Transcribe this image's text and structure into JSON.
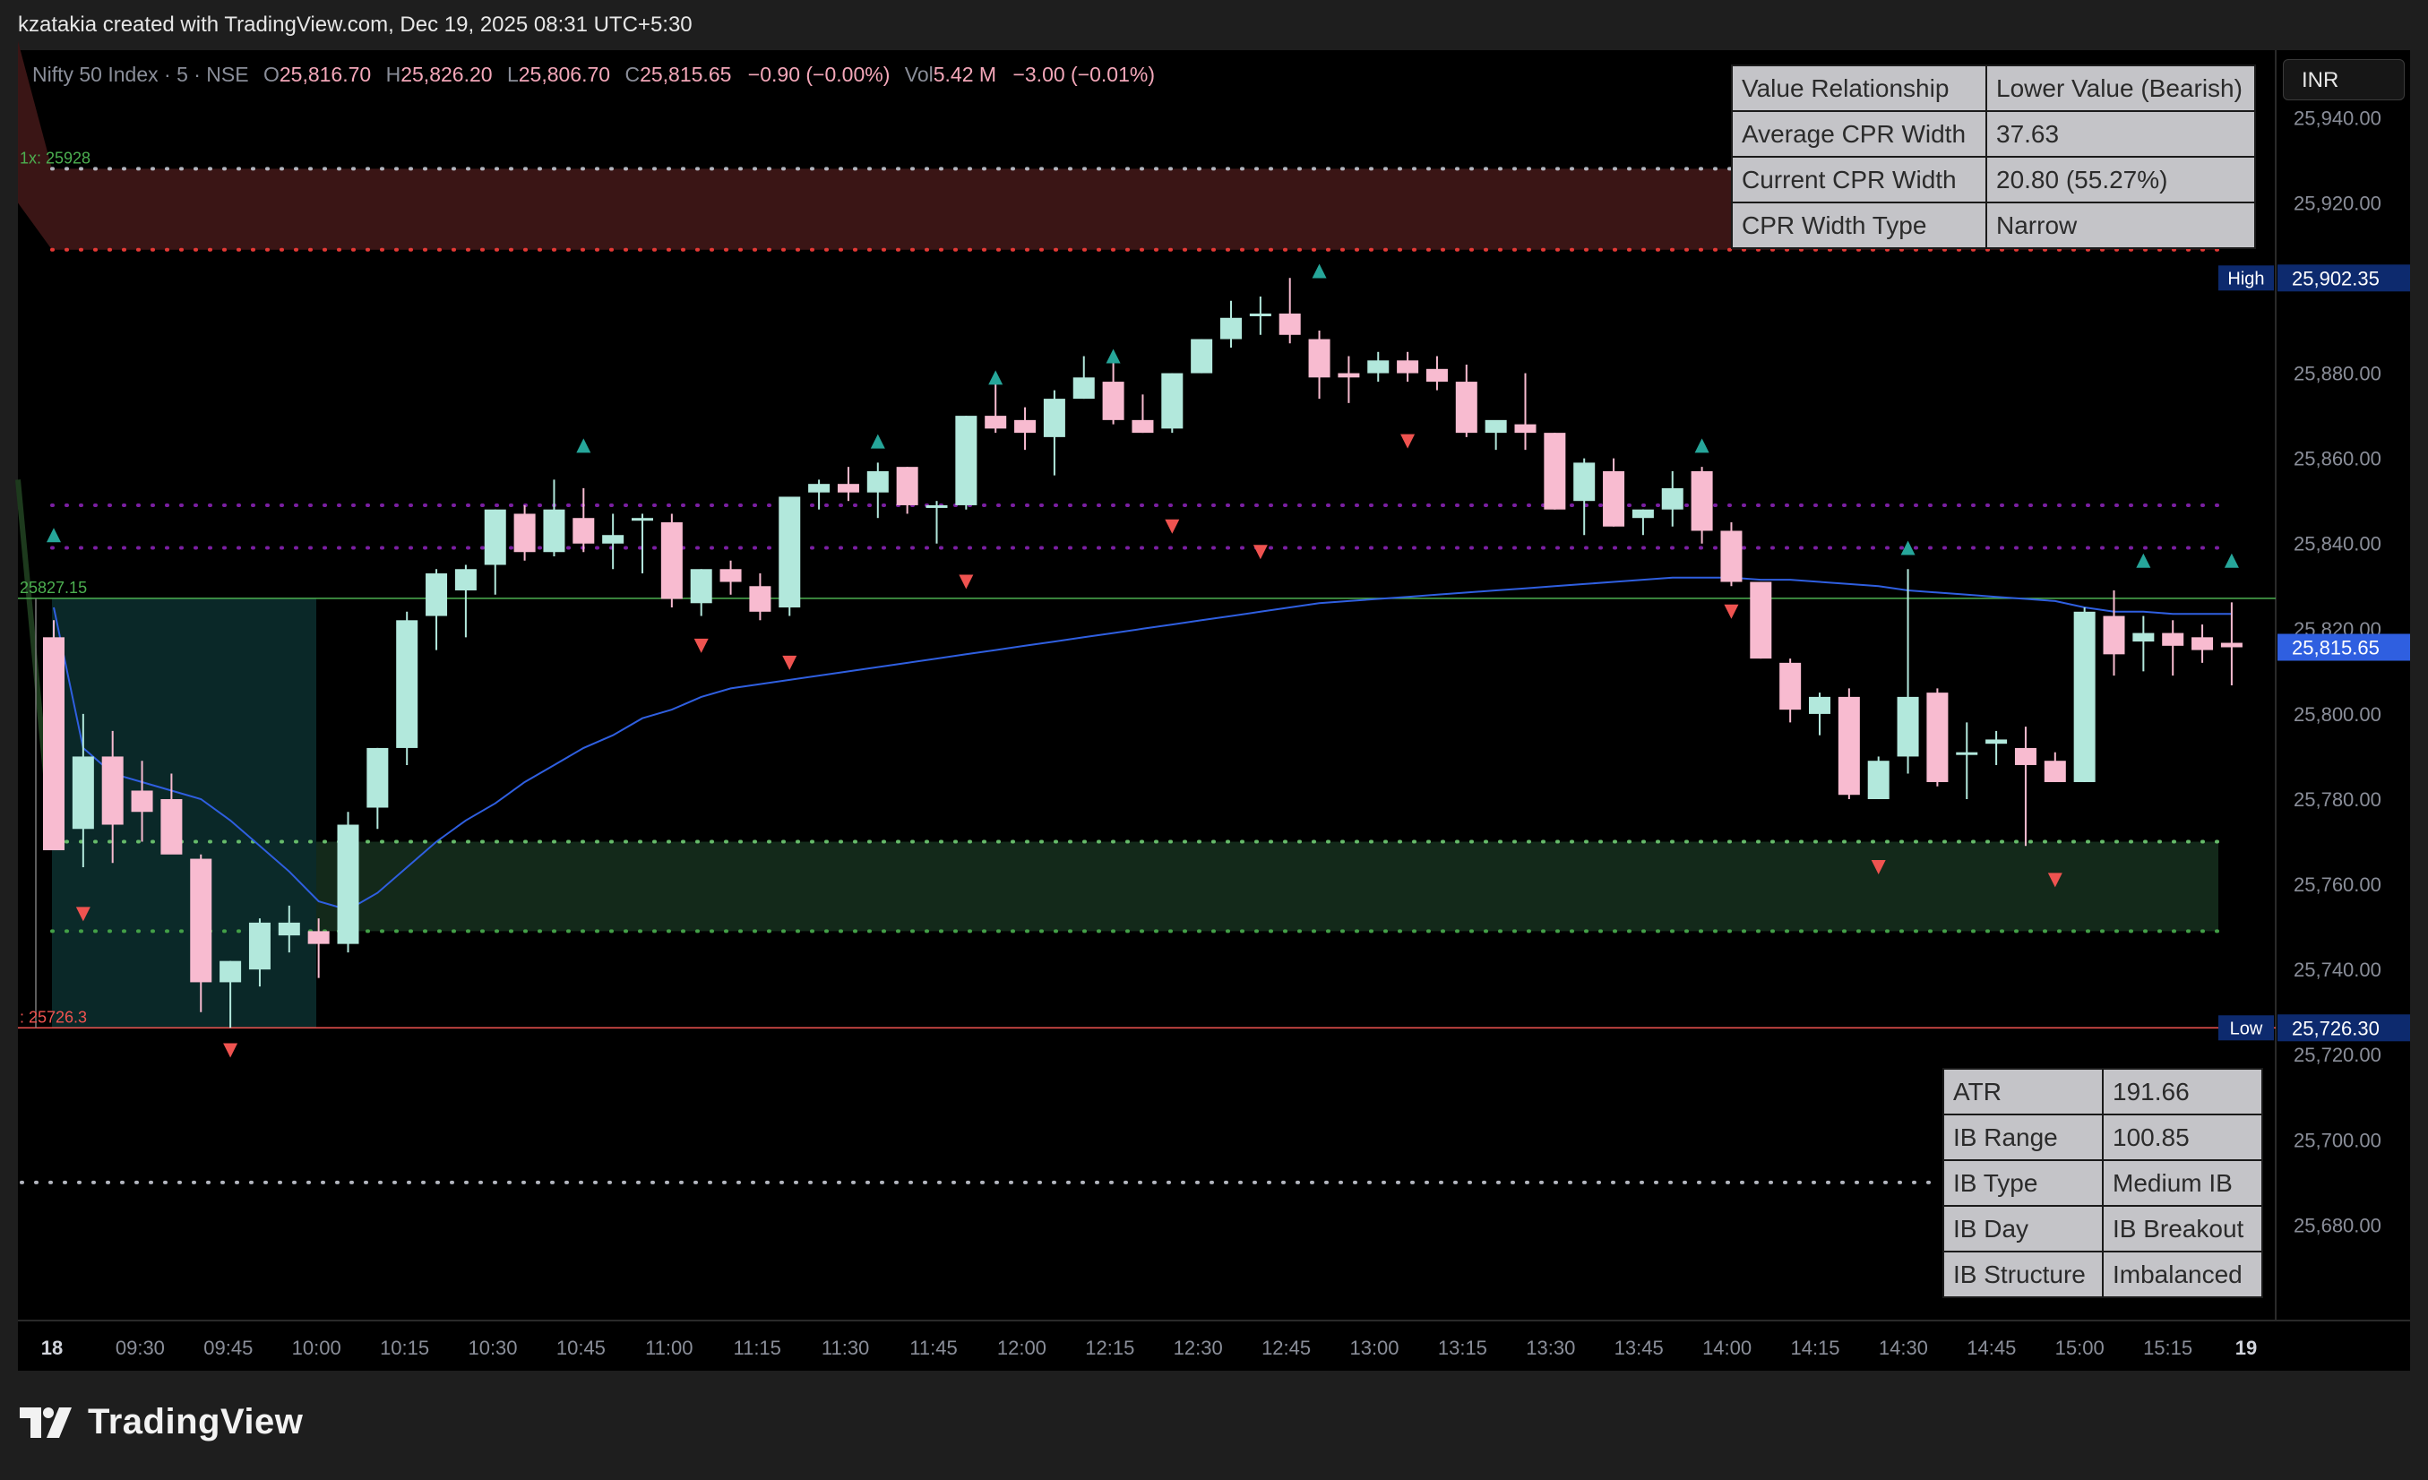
{
  "credit": "kzatakia created with TradingView.com, Dec 19, 2025 08:31 UTC+5:30",
  "brand": {
    "name": "TradingView",
    "icon": "tradingview-logo-icon"
  },
  "legend": {
    "symbol": "Nifty 50 Index · 5 · NSE",
    "o_label": "O",
    "open": "25,816.70",
    "h_label": "H",
    "high": "25,826.20",
    "l_label": "L",
    "low": "25,806.70",
    "c_label": "C",
    "close": "25,815.65",
    "change": "−0.90 (−0.00%)",
    "vol_label": "Vol",
    "volume": "5.42 M",
    "vol_change": "−3.00 (−0.01%)"
  },
  "currency": "INR",
  "cpr_table": [
    [
      "Value Relationship",
      "Lower Value (Bearish)"
    ],
    [
      "Average CPR Width",
      "37.63"
    ],
    [
      "Current CPR Width",
      "20.80 (55.27%)"
    ],
    [
      "CPR Width Type",
      "Narrow"
    ]
  ],
  "ib_table": [
    [
      "ATR",
      "191.66"
    ],
    [
      "IB Range",
      "100.85"
    ],
    [
      "IB Type",
      "Medium IB"
    ],
    [
      "IB Day",
      "IB Breakout"
    ],
    [
      "IB Structure",
      "Imbalanced"
    ]
  ],
  "chart_data": {
    "type": "candlestick",
    "title": "Nifty 50 Index · 5 · NSE",
    "x_tick_labels": [
      "18",
      "09:30",
      "09:45",
      "10:00",
      "10:15",
      "10:30",
      "10:45",
      "11:00",
      "11:15",
      "11:30",
      "11:45",
      "12:00",
      "12:15",
      "12:30",
      "12:45",
      "13:00",
      "13:15",
      "13:30",
      "13:45",
      "14:00",
      "14:15",
      "14:30",
      "14:45",
      "15:00",
      "15:15",
      "19"
    ],
    "y_tick_labels": [
      "25,940.00",
      "25,920.00",
      "25,880.00",
      "25,860.00",
      "25,840.00",
      "25,820.00",
      "25,800.00",
      "25,780.00",
      "25,760.00",
      "25,740.00",
      "25,720.00",
      "25,700.00",
      "25,680.00"
    ],
    "y_ticks": [
      25940,
      25920,
      25880,
      25860,
      25840,
      25820,
      25800,
      25780,
      25760,
      25740,
      25720,
      25700,
      25680
    ],
    "ylim": [
      25658,
      25955
    ],
    "price_labels": {
      "high": {
        "label": "High",
        "value": "25,902.35",
        "price": 25902.35
      },
      "last": {
        "value": "25,815.65",
        "price": 25815.65
      },
      "low": {
        "label": "Low",
        "value": "25,726.30",
        "price": 25726.3
      }
    },
    "line_labels": {
      "upper": {
        "text": "1x: 25928",
        "price": 25928
      },
      "mid": {
        "text": "25827.15",
        "price": 25827.15
      },
      "lower": {
        "text": ": 25726.3",
        "price": 25726.3
      }
    },
    "zones": {
      "red_band": [
        25909,
        25928
      ],
      "green_band": [
        25749,
        25770
      ],
      "initial_balance": {
        "from": "09:15",
        "to": "10:15",
        "low": 25726.3,
        "high": 25827.15
      }
    },
    "dotted_levels": [
      {
        "price": 25909,
        "color": "#e53935"
      },
      {
        "price": 25928,
        "color": "#b2b5be"
      },
      {
        "price": 25849,
        "color": "#7b1fa2"
      },
      {
        "price": 25839,
        "color": "#7b1fa2"
      },
      {
        "price": 25770,
        "color": "#66bb6a"
      },
      {
        "price": 25749,
        "color": "#43a047"
      },
      {
        "price": 25690,
        "color": "#b2b5be"
      }
    ],
    "colors": {
      "up": "#b2e8dc",
      "down": "#f8bbd0",
      "ma": "#2f5fe0",
      "buy_marker": "#26a69a",
      "sell_marker": "#ef5350",
      "mid_line": "#4caf50",
      "low_line": "#ef5350"
    },
    "series": [
      {
        "name": "Nifty 50",
        "candles": [
          [
            25818,
            25822,
            25780,
            25768
          ],
          [
            25773,
            25800,
            25764,
            25790
          ],
          [
            25790,
            25796,
            25765,
            25774
          ],
          [
            25782,
            25789,
            25770,
            25777
          ],
          [
            25780,
            25786,
            25770,
            25767
          ],
          [
            25766,
            25767,
            25730,
            25737
          ],
          [
            25737,
            25742,
            25726.3,
            25742
          ],
          [
            25740,
            25752,
            25736,
            25751
          ],
          [
            25748,
            25755,
            25744,
            25751
          ],
          [
            25749,
            25752,
            25738,
            25746
          ],
          [
            25746,
            25777,
            25744,
            25774
          ],
          [
            25778,
            25792,
            25773,
            25792
          ],
          [
            25792,
            25824,
            25788,
            25822
          ],
          [
            25823,
            25834,
            25815,
            25833
          ],
          [
            25829,
            25835,
            25818,
            25834
          ],
          [
            25835,
            25848,
            25828,
            25848
          ],
          [
            25847,
            25849,
            25836,
            25838
          ],
          [
            25838,
            25855,
            25837,
            25848
          ],
          [
            25846,
            25853,
            25838,
            25840
          ],
          [
            25840,
            25847,
            25834,
            25842
          ],
          [
            25846,
            25847,
            25833,
            25846
          ],
          [
            25845,
            25847,
            25825,
            25827
          ],
          [
            25826,
            25834,
            25823,
            25834
          ],
          [
            25834,
            25836,
            25828,
            25831
          ],
          [
            25830,
            25833,
            25822,
            25824
          ],
          [
            25825,
            25851,
            25823,
            25851
          ],
          [
            25852,
            25855,
            25848,
            25854
          ],
          [
            25854,
            25858,
            25850,
            25852
          ],
          [
            25852,
            25859,
            25846,
            25857
          ],
          [
            25858,
            25858,
            25847,
            25849
          ],
          [
            25849,
            25850,
            25840,
            25849
          ],
          [
            25849,
            25870,
            25848,
            25870
          ],
          [
            25870,
            25880,
            25866,
            25867
          ],
          [
            25869,
            25872,
            25862,
            25866
          ],
          [
            25865,
            25876,
            25856,
            25874
          ],
          [
            25874,
            25884,
            25874,
            25879
          ],
          [
            25878,
            25884,
            25868,
            25869
          ],
          [
            25869,
            25875,
            25866,
            25866
          ],
          [
            25867,
            25880,
            25866,
            25880
          ],
          [
            25880,
            25888,
            25880,
            25888
          ],
          [
            25888,
            25897,
            25886,
            25893
          ],
          [
            25894,
            25898,
            25889,
            25894
          ],
          [
            25894,
            25902.35,
            25887,
            25889
          ],
          [
            25888,
            25890,
            25874,
            25879
          ],
          [
            25880,
            25884,
            25873,
            25879
          ],
          [
            25880,
            25885,
            25878,
            25883
          ],
          [
            25883,
            25885,
            25878,
            25880
          ],
          [
            25881,
            25884,
            25876,
            25878
          ],
          [
            25878,
            25882,
            25865,
            25866
          ],
          [
            25866,
            25868,
            25862,
            25869
          ],
          [
            25868,
            25880,
            25862,
            25866
          ],
          [
            25866,
            25866,
            25848,
            25848
          ],
          [
            25850,
            25860,
            25842,
            25859
          ],
          [
            25857,
            25860,
            25844,
            25844
          ],
          [
            25846,
            25848,
            25842,
            25848
          ],
          [
            25848,
            25857,
            25844,
            25853
          ],
          [
            25857,
            25858,
            25840,
            25843
          ],
          [
            25843,
            25845,
            25830,
            25831
          ],
          [
            25831,
            25831,
            25813,
            25813
          ],
          [
            25812,
            25813,
            25798,
            25801
          ],
          [
            25800,
            25805,
            25795,
            25804
          ],
          [
            25804,
            25806,
            25780,
            25781
          ],
          [
            25780,
            25790,
            25780,
            25789
          ],
          [
            25790,
            25834,
            25786,
            25804
          ],
          [
            25805,
            25806,
            25783,
            25784
          ],
          [
            25791,
            25798,
            25780,
            25791
          ],
          [
            25793,
            25796,
            25788,
            25794
          ],
          [
            25792,
            25797,
            25769,
            25788
          ],
          [
            25789,
            25791,
            25784,
            25784
          ],
          [
            25784,
            25825,
            25784,
            25824
          ],
          [
            25823,
            25829,
            25809,
            25814
          ],
          [
            25817,
            25823,
            25810,
            25819
          ],
          [
            25819,
            25822,
            25809,
            25816
          ],
          [
            25818,
            25821,
            25812,
            25815
          ],
          [
            25816.7,
            25826.2,
            25806.7,
            25815.65
          ]
        ]
      }
    ],
    "moving_average": [
      25825,
      25792,
      25786,
      25784,
      25782,
      25780,
      25775,
      25769,
      25763,
      25756,
      25754,
      25758,
      25764,
      25770,
      25775,
      25779,
      25784,
      25788,
      25792,
      25795,
      25799,
      25801,
      25804,
      25806,
      25807,
      25808,
      25809,
      25810,
      25811,
      25812,
      25813,
      25814,
      25815,
      25816,
      25817,
      25818,
      25819,
      25820,
      25821,
      25822,
      25823,
      25824,
      25825,
      25826,
      25826.5,
      25827,
      25827.5,
      25828,
      25828.5,
      25829,
      25829.5,
      25830,
      25830.5,
      25831,
      25831.5,
      25832,
      25832,
      25832,
      25831.5,
      25831.5,
      25831,
      25830.5,
      25830,
      25829,
      25828.5,
      25828,
      25827.5,
      25827,
      25826.5,
      25825,
      25824,
      25824,
      25823.5,
      25823.5,
      25823.5
    ],
    "buy_markers": [
      0,
      18,
      28,
      32,
      36,
      43,
      56,
      63,
      74,
      71
    ],
    "sell_markers": [
      1,
      6,
      22,
      25,
      31,
      38,
      41,
      46,
      57,
      62,
      68
    ],
    "marker_offsets": {
      "0": 25842,
      "18": 25863,
      "28": 25864,
      "32": 25879,
      "36": 25884,
      "43": 25904,
      "56": 25863,
      "63": 25839,
      "74": 25836,
      "71": 25836,
      "1": 25753,
      "6": 25721,
      "22": 25816,
      "25": 25812,
      "31": 25831,
      "38": 25844,
      "41": 25838,
      "46": 25864,
      "57": 25824,
      "62": 25764,
      "68": 25761
    }
  }
}
